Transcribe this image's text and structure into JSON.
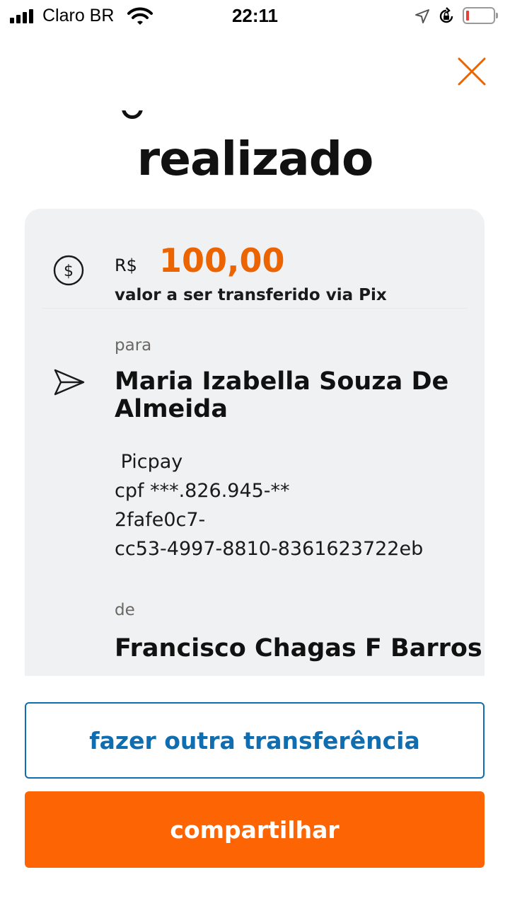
{
  "status_bar": {
    "carrier": "Claro BR",
    "time": "22:11",
    "icons": [
      "cellular-signal-icon",
      "wifi-icon",
      "location-arrow-icon",
      "orientation-lock-icon",
      "battery-low-icon"
    ]
  },
  "header": {
    "close_icon": "close-icon",
    "title": "realizado"
  },
  "transfer": {
    "currency": "R$",
    "amount": "100,00",
    "amount_description": "valor a ser transferido via Pix",
    "to_label": "para",
    "recipient_name": "Maria Izabella Souza De Almeida",
    "recipient_bank": " Picpay",
    "recipient_cpf": "cpf ***.826.945-**",
    "pix_key_line1": "2fafe0c7-",
    "pix_key_line2": "cc53-4997-8810-8361623722eb",
    "from_label": "de",
    "sender_name": "Francisco Chagas F Barros"
  },
  "actions": {
    "another_transfer": "fazer outra transferência",
    "share": "compartilhar"
  },
  "colors": {
    "accent_orange": "#ec6400",
    "primary_button": "#fd6404",
    "outline_blue": "#106eb0",
    "card_background": "#f0f1f2"
  }
}
